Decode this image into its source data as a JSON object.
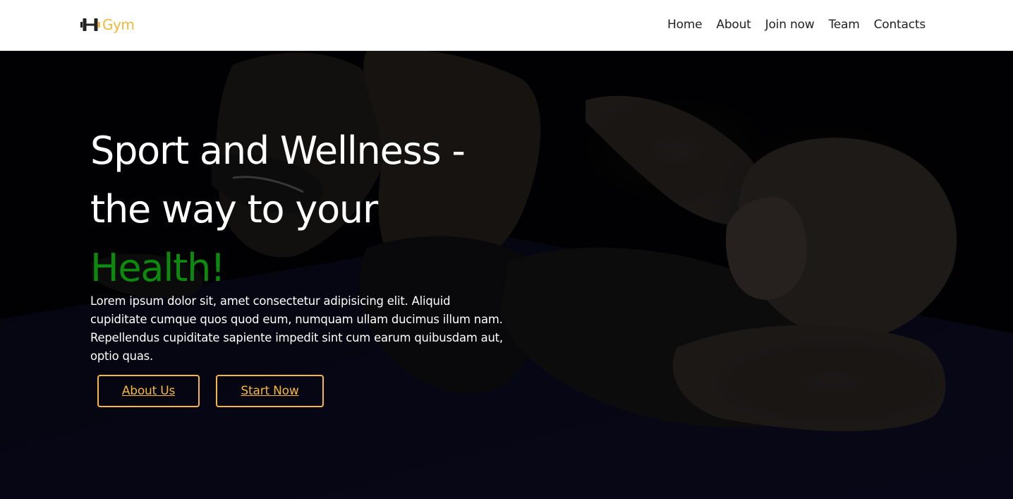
{
  "header": {
    "logo": {
      "icon": "dumbbell-icon",
      "text": "Gym",
      "color": "#f5b83c"
    },
    "nav": [
      {
        "label": "Home"
      },
      {
        "label": "About"
      },
      {
        "label": "Join now"
      },
      {
        "label": "Team"
      },
      {
        "label": "Contacts"
      }
    ]
  },
  "hero": {
    "title_line1": "Sport and Wellness -",
    "title_line2": "the way to your",
    "title_accent": "Health!",
    "accent_color": "#0b8a0b",
    "text": "Lorem ipsum dolor sit, amet consectetur adipisicing elit. Aliquid cupiditate cumque quos quod eum, numquam ullam ducimus illum nam. Repellendus cupiditate sapiente impedit sint cum earum quibusdam aut, optio quas.",
    "buttons": {
      "about_label": "About Us",
      "start_label": "Start Now",
      "color": "#f5b83c"
    },
    "background": "woman-doing-crunches-photo"
  }
}
